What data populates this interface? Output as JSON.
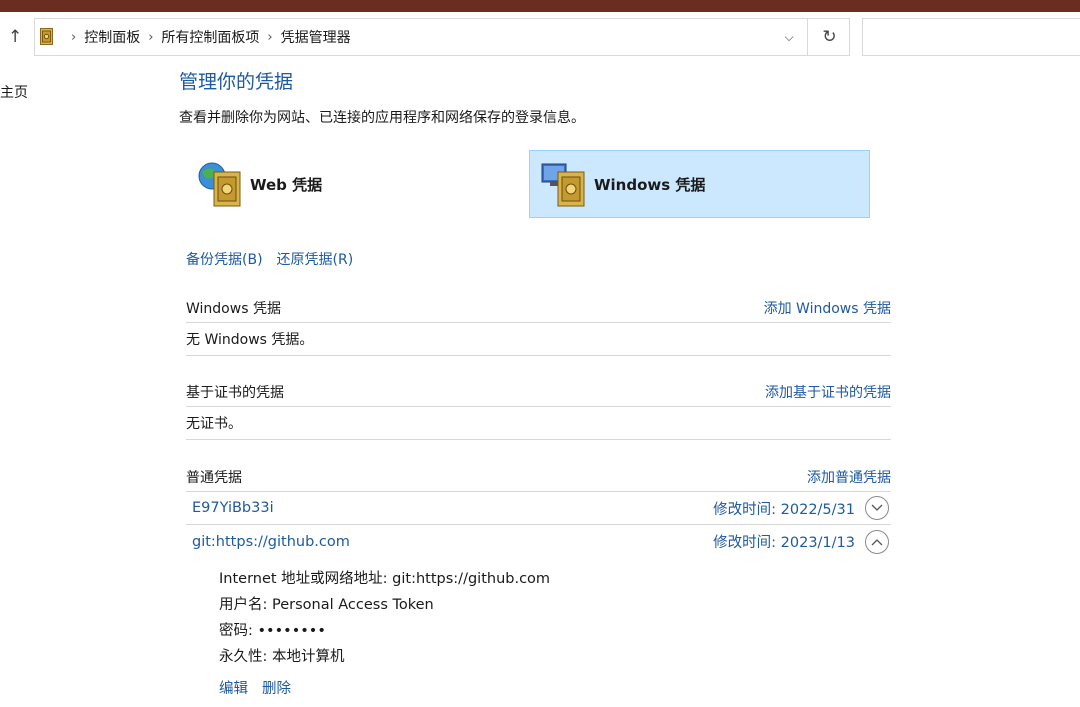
{
  "nav": {
    "breadcrumbs": [
      "控制面板",
      "所有控制面板项",
      "凭据管理器"
    ],
    "home_label": "主页"
  },
  "header": {
    "title": "管理你的凭据",
    "description": "查看并删除你为网站、已连接的应用程序和网络保存的登录信息。"
  },
  "types": {
    "web_label": "Web 凭据",
    "windows_label": "Windows 凭据",
    "selected": "windows"
  },
  "backup": {
    "backup_label": "备份凭据(B)",
    "restore_label": "还原凭据(R)"
  },
  "sections": {
    "windows": {
      "title": "Windows 凭据",
      "add_label": "添加 Windows 凭据",
      "empty_text": "无 Windows 凭据。"
    },
    "certificate": {
      "title": "基于证书的凭据",
      "add_label": "添加基于证书的凭据",
      "empty_text": "无证书。"
    },
    "generic": {
      "title": "普通凭据",
      "add_label": "添加普通凭据",
      "items": [
        {
          "name": "E97YiBb33i",
          "modified": "修改时间:  2022/5/31",
          "expanded": false
        },
        {
          "name": "git:https://github.com",
          "modified": "修改时间:  2023/1/13",
          "expanded": true
        }
      ],
      "details": {
        "address": "Internet 地址或网络地址:  git:https://github.com",
        "username": "用户名:  Personal Access Token",
        "password": "密码:  ••••••••",
        "persistence": "永久性:  本地计算机",
        "edit_label": "编辑",
        "delete_label": "删除"
      }
    }
  },
  "colors": {
    "link": "#1e5aa0",
    "selected_tile": "#cce8ff",
    "titlebar": "#6b2d1f"
  }
}
